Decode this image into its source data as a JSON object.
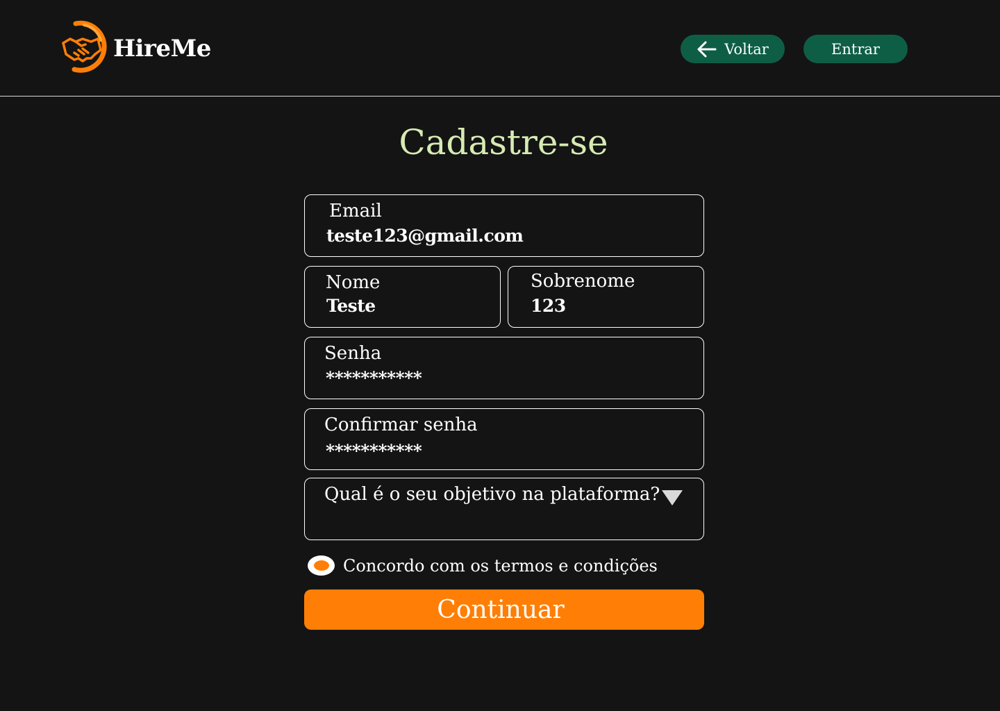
{
  "brand": {
    "name": "HireMe",
    "logo_icon": "handshake-logo-icon",
    "accent_color": "#ff7f06"
  },
  "nav": {
    "back_label": "Voltar",
    "back_icon": "arrow-left-icon",
    "login_label": "Entrar",
    "button_color": "#0e5e46"
  },
  "page": {
    "title": "Cadastre-se",
    "title_color": "#d6ebb2"
  },
  "form": {
    "email": {
      "label": "Email",
      "value": "teste123@gmail.com"
    },
    "first_name": {
      "label": "Nome",
      "value": "Teste"
    },
    "last_name": {
      "label": "Sobrenome",
      "value": "123"
    },
    "password": {
      "label": "Senha",
      "value": "***********"
    },
    "confirm_password": {
      "label": "Confirmar senha",
      "value": "***********"
    },
    "objective": {
      "label": "Qual é o seu objetivo na plataforma?",
      "icon": "triangle-down-icon"
    },
    "terms": {
      "label": "Concordo com os termos e condições",
      "checked": true
    },
    "submit_label": "Continuar"
  }
}
